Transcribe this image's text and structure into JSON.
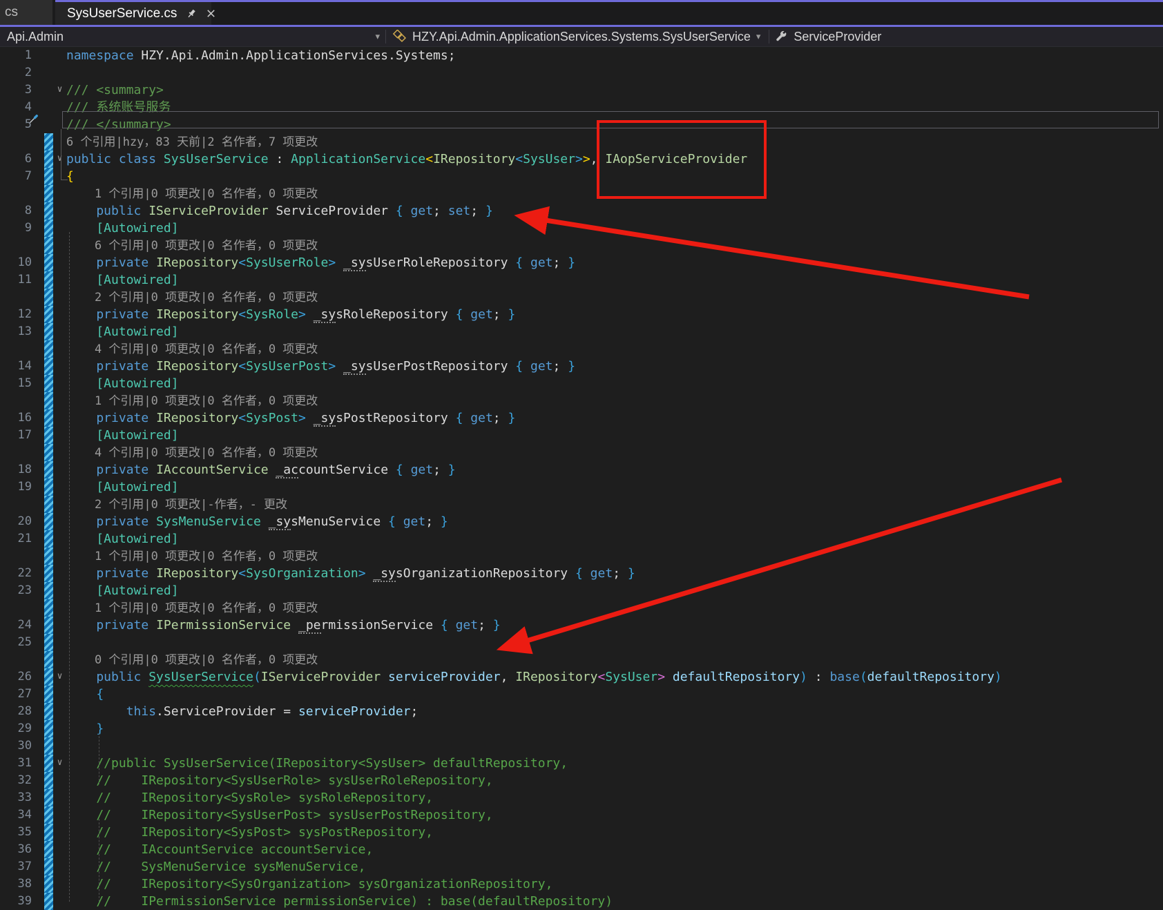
{
  "window": {
    "tabs": {
      "partial_label": "cs",
      "active_label": "SysUserService.cs"
    }
  },
  "breadcrumb": {
    "project": "Api.Admin",
    "type_path": "HZY.Api.Admin.ApplicationServices.Systems.SysUserService",
    "member": "ServiceProvider"
  },
  "colors": {
    "accent_purple": "#6E6AD8",
    "annotation_red": "#EC1C12",
    "editor_background": "#1E1E1E",
    "keyword_blue": "#569CD6",
    "type_teal": "#4EC9B0",
    "interface_green": "#B8D7A3",
    "parameter_blue": "#9CDCFE",
    "comment_green": "#57A64A",
    "codelens_gray": "#9B9B9B",
    "brace_gold": "#FFD602",
    "brace_blue": "#3BA3DE",
    "brace_pink": "#D670D6"
  },
  "editor": {
    "rows": [
      {
        "type": "code",
        "line": 1,
        "seg": [
          [
            "k",
            "namespace"
          ],
          [
            "t",
            " HZY.Api.Admin.ApplicationServices.Systems;"
          ]
        ]
      },
      {
        "type": "code",
        "line": 2,
        "seg": []
      },
      {
        "type": "code",
        "line": 3,
        "fold": true,
        "seg": [
          [
            "d",
            "/// <summary>"
          ]
        ]
      },
      {
        "type": "code",
        "line": 4,
        "seg": [
          [
            "d",
            "/// 系统账号服务"
          ]
        ]
      },
      {
        "type": "code",
        "line": 5,
        "seg": [
          [
            "d",
            "/// </summary>"
          ]
        ]
      },
      {
        "type": "codelens",
        "seg": [
          [
            "l",
            "6 个引用|hzy，83 天前|2 名作者，7 项更改"
          ]
        ]
      },
      {
        "type": "code",
        "line": 6,
        "fold": true,
        "seg": [
          [
            "k",
            "public"
          ],
          [
            "t",
            " "
          ],
          [
            "k",
            "class"
          ],
          [
            "t",
            " "
          ],
          [
            "c",
            "SysUserService"
          ],
          [
            "t",
            " : "
          ],
          [
            "c",
            "ApplicationService"
          ],
          [
            "g1",
            "<"
          ],
          [
            "i",
            "IRepository"
          ],
          [
            "g2",
            "<"
          ],
          [
            "c",
            "SysUser"
          ],
          [
            "g2",
            ">"
          ],
          [
            "g1",
            ">"
          ],
          [
            "t",
            ", "
          ],
          [
            "i",
            "IAopServiceProvider"
          ]
        ]
      },
      {
        "type": "code",
        "line": 7,
        "seg": [
          [
            "g1",
            "{"
          ]
        ]
      },
      {
        "type": "codelens",
        "seg": [
          [
            "l",
            "    1 个引用|0 项更改|0 名作者，0 项更改"
          ]
        ]
      },
      {
        "type": "code",
        "line": 8,
        "seg": [
          [
            "k",
            "    public"
          ],
          [
            "t",
            " "
          ],
          [
            "i",
            "IServiceProvider"
          ],
          [
            "t",
            " ServiceProvider "
          ],
          [
            "g2",
            "{"
          ],
          [
            "t",
            " "
          ],
          [
            "k",
            "get"
          ],
          [
            "t",
            "; "
          ],
          [
            "k",
            "set"
          ],
          [
            "t",
            "; "
          ],
          [
            "g2",
            "}"
          ]
        ]
      },
      {
        "type": "code",
        "line": 9,
        "seg": [
          [
            "c",
            "    [Autowired]"
          ]
        ]
      },
      {
        "type": "codelens",
        "seg": [
          [
            "l",
            "    6 个引用|0 项更改|0 名作者，0 项更改"
          ]
        ]
      },
      {
        "type": "code",
        "line": 10,
        "seg": [
          [
            "k",
            "    private"
          ],
          [
            "t",
            " "
          ],
          [
            "i",
            "IRepository"
          ],
          [
            "g2",
            "<"
          ],
          [
            "c",
            "SysUserRole"
          ],
          [
            "g2",
            ">"
          ],
          [
            "t",
            " "
          ],
          [
            "s",
            "_sysUserRoleRepository"
          ],
          [
            "t",
            " "
          ],
          [
            "g2",
            "{"
          ],
          [
            "t",
            " "
          ],
          [
            "k",
            "get"
          ],
          [
            "t",
            "; "
          ],
          [
            "g2",
            "}"
          ]
        ]
      },
      {
        "type": "code",
        "line": 11,
        "seg": [
          [
            "c",
            "    [Autowired]"
          ]
        ]
      },
      {
        "type": "codelens",
        "seg": [
          [
            "l",
            "    2 个引用|0 项更改|0 名作者，0 项更改"
          ]
        ]
      },
      {
        "type": "code",
        "line": 12,
        "seg": [
          [
            "k",
            "    private"
          ],
          [
            "t",
            " "
          ],
          [
            "i",
            "IRepository"
          ],
          [
            "g2",
            "<"
          ],
          [
            "c",
            "SysRole"
          ],
          [
            "g2",
            ">"
          ],
          [
            "t",
            " "
          ],
          [
            "s",
            "_sysRoleRepository"
          ],
          [
            "t",
            " "
          ],
          [
            "g2",
            "{"
          ],
          [
            "t",
            " "
          ],
          [
            "k",
            "get"
          ],
          [
            "t",
            "; "
          ],
          [
            "g2",
            "}"
          ]
        ]
      },
      {
        "type": "code",
        "line": 13,
        "seg": [
          [
            "c",
            "    [Autowired]"
          ]
        ]
      },
      {
        "type": "codelens",
        "seg": [
          [
            "l",
            "    4 个引用|0 项更改|0 名作者，0 项更改"
          ]
        ]
      },
      {
        "type": "code",
        "line": 14,
        "seg": [
          [
            "k",
            "    private"
          ],
          [
            "t",
            " "
          ],
          [
            "i",
            "IRepository"
          ],
          [
            "g2",
            "<"
          ],
          [
            "c",
            "SysUserPost"
          ],
          [
            "g2",
            ">"
          ],
          [
            "t",
            " "
          ],
          [
            "s",
            "_sysUserPostRepository"
          ],
          [
            "t",
            " "
          ],
          [
            "g2",
            "{"
          ],
          [
            "t",
            " "
          ],
          [
            "k",
            "get"
          ],
          [
            "t",
            "; "
          ],
          [
            "g2",
            "}"
          ]
        ]
      },
      {
        "type": "code",
        "line": 15,
        "seg": [
          [
            "c",
            "    [Autowired]"
          ]
        ]
      },
      {
        "type": "codelens",
        "seg": [
          [
            "l",
            "    1 个引用|0 项更改|0 名作者，0 项更改"
          ]
        ]
      },
      {
        "type": "code",
        "line": 16,
        "seg": [
          [
            "k",
            "    private"
          ],
          [
            "t",
            " "
          ],
          [
            "i",
            "IRepository"
          ],
          [
            "g2",
            "<"
          ],
          [
            "c",
            "SysPost"
          ],
          [
            "g2",
            ">"
          ],
          [
            "t",
            " "
          ],
          [
            "s",
            "_sysPostRepository"
          ],
          [
            "t",
            " "
          ],
          [
            "g2",
            "{"
          ],
          [
            "t",
            " "
          ],
          [
            "k",
            "get"
          ],
          [
            "t",
            "; "
          ],
          [
            "g2",
            "}"
          ]
        ]
      },
      {
        "type": "code",
        "line": 17,
        "seg": [
          [
            "c",
            "    [Autowired]"
          ]
        ]
      },
      {
        "type": "codelens",
        "seg": [
          [
            "l",
            "    4 个引用|0 项更改|0 名作者，0 项更改"
          ]
        ]
      },
      {
        "type": "code",
        "line": 18,
        "seg": [
          [
            "k",
            "    private"
          ],
          [
            "t",
            " "
          ],
          [
            "i",
            "IAccountService"
          ],
          [
            "t",
            " "
          ],
          [
            "s",
            "_accountService"
          ],
          [
            "t",
            " "
          ],
          [
            "g2",
            "{"
          ],
          [
            "t",
            " "
          ],
          [
            "k",
            "get"
          ],
          [
            "t",
            "; "
          ],
          [
            "g2",
            "}"
          ]
        ]
      },
      {
        "type": "code",
        "line": 19,
        "seg": [
          [
            "c",
            "    [Autowired]"
          ]
        ]
      },
      {
        "type": "codelens",
        "seg": [
          [
            "l",
            "    2 个引用|0 项更改|-作者，- 更改"
          ]
        ]
      },
      {
        "type": "code",
        "line": 20,
        "seg": [
          [
            "k",
            "    private"
          ],
          [
            "t",
            " "
          ],
          [
            "c",
            "SysMenuService"
          ],
          [
            "t",
            " "
          ],
          [
            "s",
            "_sysMenuService"
          ],
          [
            "t",
            " "
          ],
          [
            "g2",
            "{"
          ],
          [
            "t",
            " "
          ],
          [
            "k",
            "get"
          ],
          [
            "t",
            "; "
          ],
          [
            "g2",
            "}"
          ]
        ]
      },
      {
        "type": "code",
        "line": 21,
        "seg": [
          [
            "c",
            "    [Autowired]"
          ]
        ]
      },
      {
        "type": "codelens",
        "seg": [
          [
            "l",
            "    1 个引用|0 项更改|0 名作者，0 项更改"
          ]
        ]
      },
      {
        "type": "code",
        "line": 22,
        "seg": [
          [
            "k",
            "    private"
          ],
          [
            "t",
            " "
          ],
          [
            "i",
            "IRepository"
          ],
          [
            "g2",
            "<"
          ],
          [
            "c",
            "SysOrganization"
          ],
          [
            "g2",
            ">"
          ],
          [
            "t",
            " "
          ],
          [
            "s",
            "_sysOrganizationRepository"
          ],
          [
            "t",
            " "
          ],
          [
            "g2",
            "{"
          ],
          [
            "t",
            " "
          ],
          [
            "k",
            "get"
          ],
          [
            "t",
            "; "
          ],
          [
            "g2",
            "}"
          ]
        ]
      },
      {
        "type": "code",
        "line": 23,
        "seg": [
          [
            "c",
            "    [Autowired]"
          ]
        ]
      },
      {
        "type": "codelens",
        "seg": [
          [
            "l",
            "    1 个引用|0 项更改|0 名作者，0 项更改"
          ]
        ]
      },
      {
        "type": "code",
        "line": 24,
        "seg": [
          [
            "k",
            "    private"
          ],
          [
            "t",
            " "
          ],
          [
            "i",
            "IPermissionService"
          ],
          [
            "t",
            " "
          ],
          [
            "s",
            "_permissionService"
          ],
          [
            "t",
            " "
          ],
          [
            "g2",
            "{"
          ],
          [
            "t",
            " "
          ],
          [
            "k",
            "get"
          ],
          [
            "t",
            "; "
          ],
          [
            "g2",
            "}"
          ]
        ]
      },
      {
        "type": "code",
        "line": 25,
        "seg": []
      },
      {
        "type": "codelens",
        "seg": [
          [
            "l",
            "    0 个引用|0 项更改|0 名作者，0 项更改"
          ]
        ]
      },
      {
        "type": "code",
        "line": 26,
        "fold": true,
        "seg": [
          [
            "k",
            "    public"
          ],
          [
            "t",
            " "
          ],
          [
            "cw",
            "SysUserService"
          ],
          [
            "g2",
            "("
          ],
          [
            "i",
            "IServiceProvider"
          ],
          [
            "t",
            " "
          ],
          [
            "p",
            "serviceProvider"
          ],
          [
            "t",
            ", "
          ],
          [
            "i",
            "IRepository"
          ],
          [
            "g3",
            "<"
          ],
          [
            "c",
            "SysUser"
          ],
          [
            "g3",
            ">"
          ],
          [
            "t",
            " "
          ],
          [
            "p",
            "defaultRepository"
          ],
          [
            "g2",
            ")"
          ],
          [
            "t",
            " : "
          ],
          [
            "k",
            "base"
          ],
          [
            "g2",
            "("
          ],
          [
            "p",
            "defaultRepository"
          ],
          [
            "g2",
            ")"
          ]
        ]
      },
      {
        "type": "code",
        "line": 27,
        "seg": [
          [
            "g2",
            "    {"
          ]
        ]
      },
      {
        "type": "code",
        "line": 28,
        "seg": [
          [
            "k",
            "        this"
          ],
          [
            "t",
            ".ServiceProvider = "
          ],
          [
            "p",
            "serviceProvider"
          ],
          [
            "t",
            ";"
          ]
        ]
      },
      {
        "type": "code",
        "line": 29,
        "seg": [
          [
            "g2",
            "    }"
          ]
        ]
      },
      {
        "type": "code",
        "line": 30,
        "seg": []
      },
      {
        "type": "code",
        "line": 31,
        "fold": true,
        "seg": [
          [
            "m",
            "    //public SysUserService(IRepository<SysUser> defaultRepository,"
          ]
        ]
      },
      {
        "type": "code",
        "line": 32,
        "seg": [
          [
            "m",
            "    //    IRepository<SysUserRole> sysUserRoleRepository,"
          ]
        ]
      },
      {
        "type": "code",
        "line": 33,
        "seg": [
          [
            "m",
            "    //    IRepository<SysRole> sysRoleRepository,"
          ]
        ]
      },
      {
        "type": "code",
        "line": 34,
        "seg": [
          [
            "m",
            "    //    IRepository<SysUserPost> sysUserPostRepository,"
          ]
        ]
      },
      {
        "type": "code",
        "line": 35,
        "seg": [
          [
            "m",
            "    //    IRepository<SysPost> sysPostRepository,"
          ]
        ]
      },
      {
        "type": "code",
        "line": 36,
        "seg": [
          [
            "m",
            "    //    IAccountService accountService,"
          ]
        ]
      },
      {
        "type": "code",
        "line": 37,
        "seg": [
          [
            "m",
            "    //    SysMenuService sysMenuService,"
          ]
        ]
      },
      {
        "type": "code",
        "line": 38,
        "seg": [
          [
            "m",
            "    //    IRepository<SysOrganization> sysOrganizationRepository,"
          ]
        ]
      },
      {
        "type": "code",
        "line": 39,
        "seg": [
          [
            "m",
            "    //    IPermissionService permissionService) : base(defaultRepository)"
          ]
        ]
      }
    ]
  }
}
